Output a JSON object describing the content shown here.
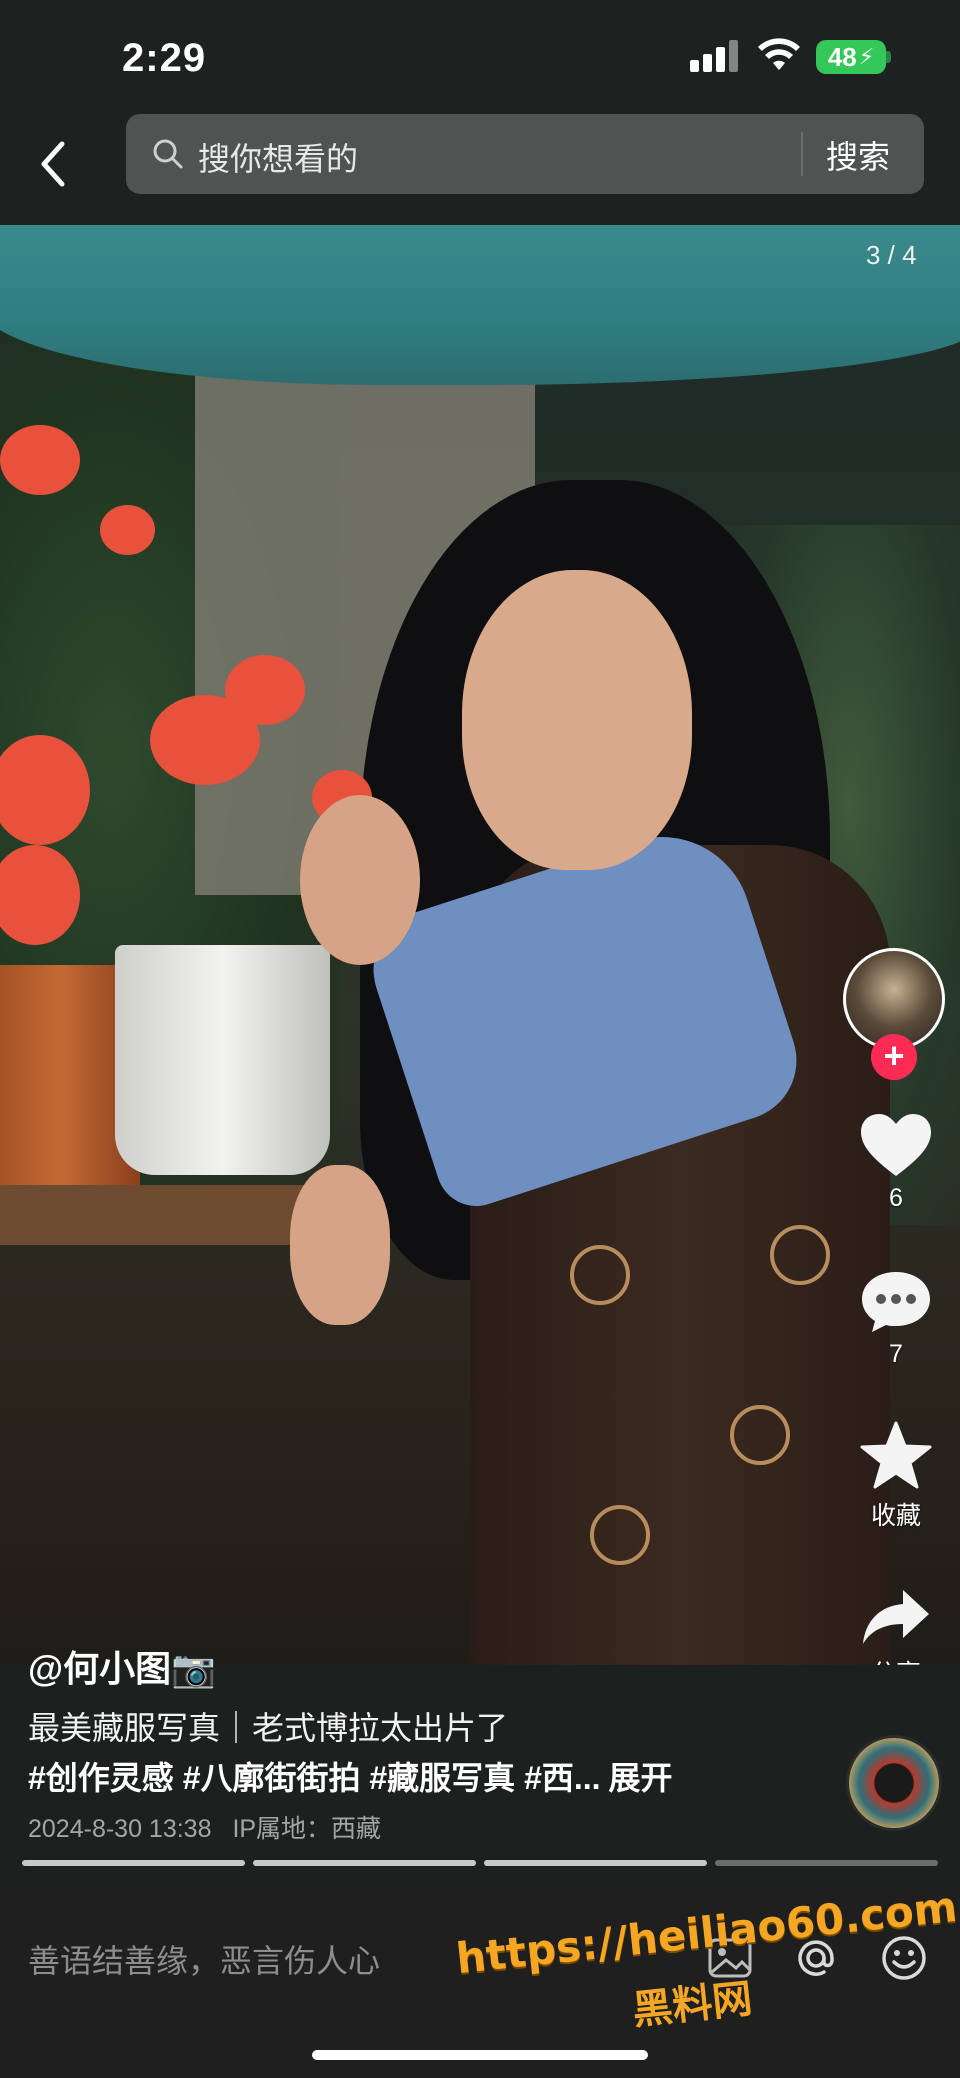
{
  "status_bar": {
    "time": "2:29",
    "battery": "48"
  },
  "header": {
    "search_placeholder": "搜你想看的",
    "search_button": "搜索"
  },
  "post": {
    "image_index": "3 / 4",
    "author": "@何小图📷",
    "title": "最美藏服写真｜老式博拉太出片了",
    "tags": "#创作灵感 #八廓街街拍 #藏服写真 #西...",
    "expand": "展开",
    "datetime": "2024-8-30 13:38",
    "ip_location": "IP属地：西藏",
    "progress": {
      "total": 4,
      "current": 3
    }
  },
  "actions": {
    "like_count": "6",
    "comment_count": "7",
    "collect_label": "收藏",
    "share_label": "分享"
  },
  "comment_bar": {
    "placeholder": "善语结善缘，恶言伤人心"
  },
  "watermark": {
    "url": "https://heiliao60.com",
    "name": "黑料网"
  },
  "colors": {
    "accent": "#fe2c55",
    "watermark": "#f5a623",
    "background": "#1d2220"
  }
}
